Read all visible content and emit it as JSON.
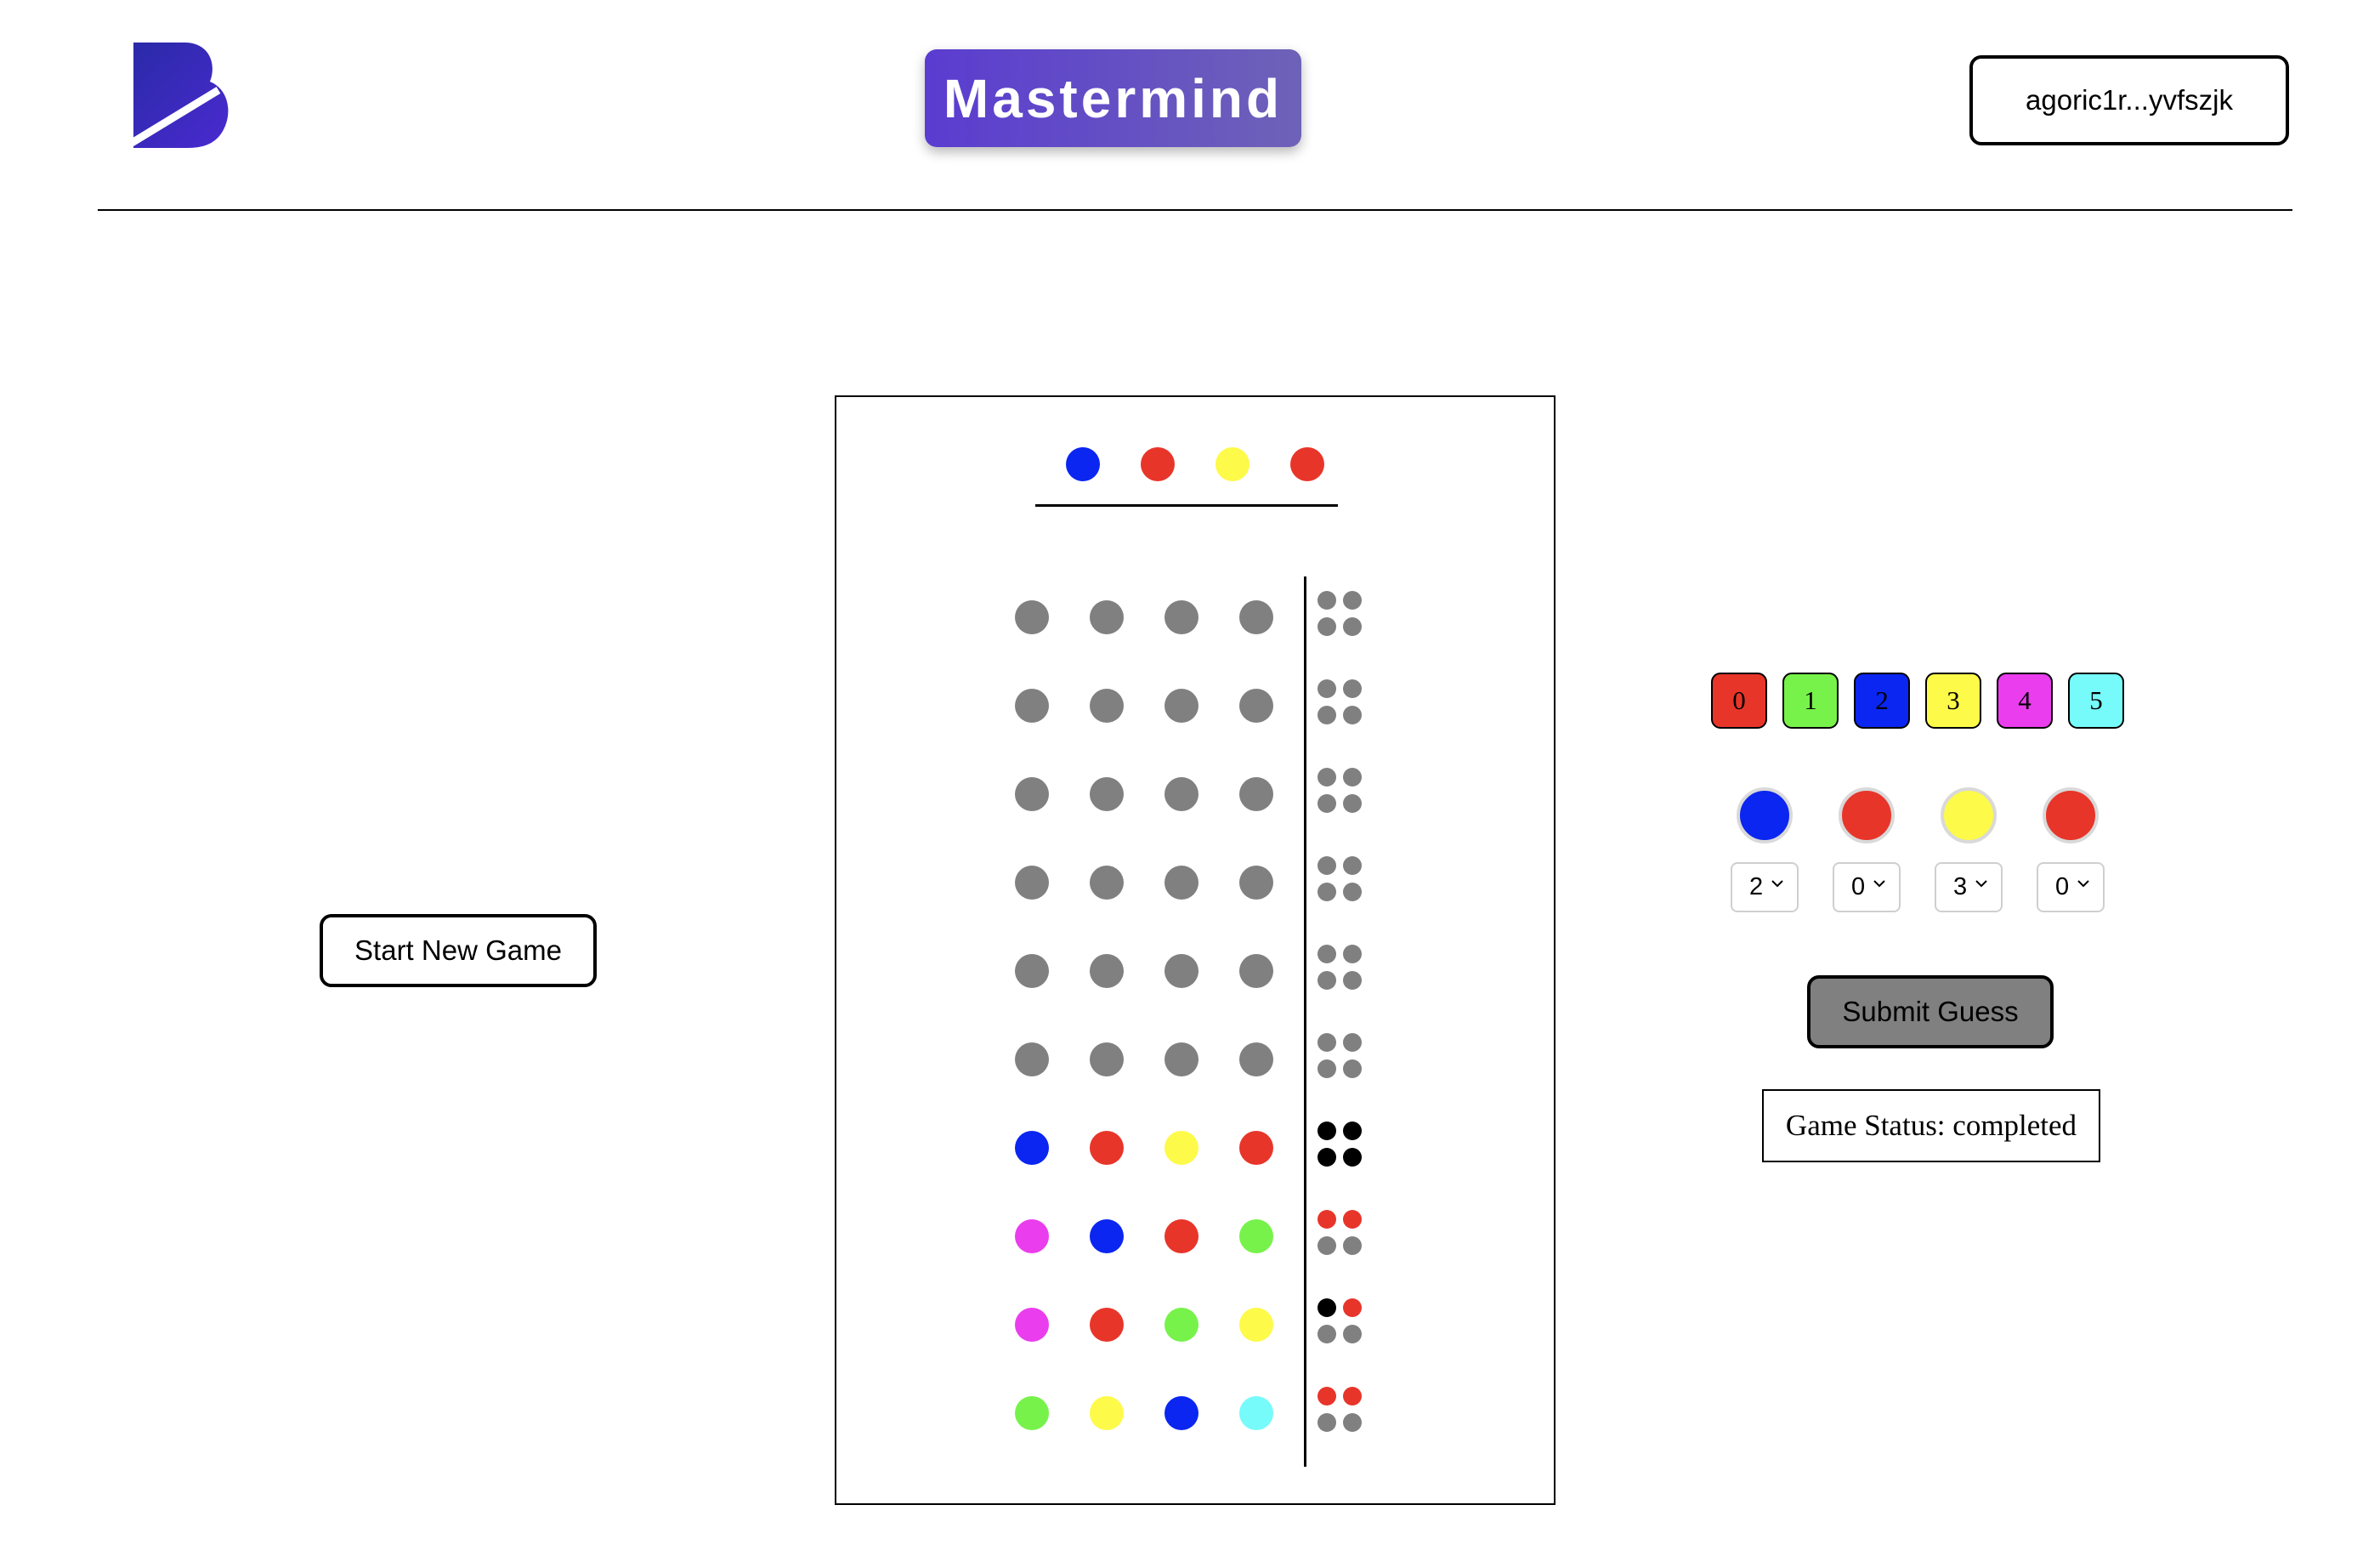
{
  "header": {
    "title": "Mastermind",
    "wallet_address": "agoric1r...yvfszjk"
  },
  "controls": {
    "new_game_label": "Start New Game",
    "submit_label": "Submit Guess"
  },
  "status": {
    "text": "Game Status: completed"
  },
  "colors": {
    "0": "#e8352a",
    "1": "#77f24a",
    "2": "#0a26f0",
    "3": "#fdfa4a",
    "4": "#ea3ded",
    "5": "#76fbfa",
    "empty": "#808080",
    "black_peg": "#000000",
    "white_peg": "#e8352a",
    "brand_gradient_start": "#5a3cd0",
    "brand_gradient_end": "#6e62b8"
  },
  "palette": [
    "0",
    "1",
    "2",
    "3",
    "4",
    "5"
  ],
  "secret_code": [
    "2",
    "0",
    "3",
    "0"
  ],
  "board_rows": [
    {
      "pegs": [
        "empty",
        "empty",
        "empty",
        "empty"
      ],
      "feedback": [
        "empty",
        "empty",
        "empty",
        "empty"
      ]
    },
    {
      "pegs": [
        "empty",
        "empty",
        "empty",
        "empty"
      ],
      "feedback": [
        "empty",
        "empty",
        "empty",
        "empty"
      ]
    },
    {
      "pegs": [
        "empty",
        "empty",
        "empty",
        "empty"
      ],
      "feedback": [
        "empty",
        "empty",
        "empty",
        "empty"
      ]
    },
    {
      "pegs": [
        "empty",
        "empty",
        "empty",
        "empty"
      ],
      "feedback": [
        "empty",
        "empty",
        "empty",
        "empty"
      ]
    },
    {
      "pegs": [
        "empty",
        "empty",
        "empty",
        "empty"
      ],
      "feedback": [
        "empty",
        "empty",
        "empty",
        "empty"
      ]
    },
    {
      "pegs": [
        "empty",
        "empty",
        "empty",
        "empty"
      ],
      "feedback": [
        "empty",
        "empty",
        "empty",
        "empty"
      ]
    },
    {
      "pegs": [
        "2",
        "0",
        "3",
        "0"
      ],
      "feedback": [
        "black",
        "black",
        "black",
        "black"
      ]
    },
    {
      "pegs": [
        "4",
        "2",
        "0",
        "1"
      ],
      "feedback": [
        "white",
        "white",
        "empty",
        "empty"
      ]
    },
    {
      "pegs": [
        "4",
        "0",
        "1",
        "3"
      ],
      "feedback": [
        "black",
        "white",
        "empty",
        "empty"
      ]
    },
    {
      "pegs": [
        "1",
        "3",
        "2",
        "5"
      ],
      "feedback": [
        "white",
        "white",
        "empty",
        "empty"
      ]
    }
  ],
  "current_guess": {
    "pegs": [
      "2",
      "0",
      "3",
      "0"
    ],
    "selects": [
      "2",
      "0",
      "3",
      "0"
    ]
  }
}
